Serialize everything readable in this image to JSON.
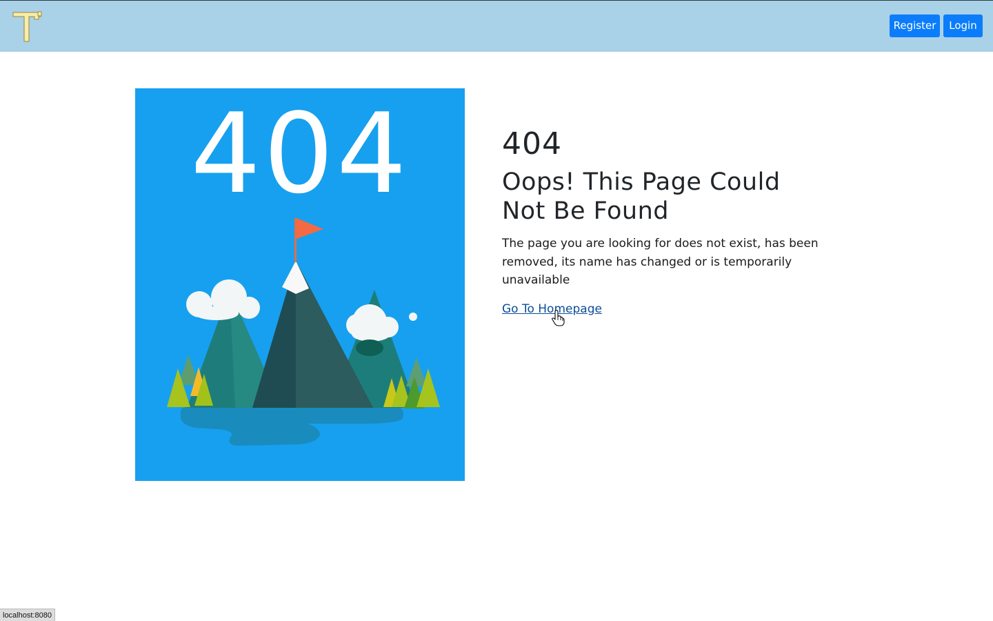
{
  "header": {
    "logo_icon": "hammer-icon",
    "register_label": "Register",
    "login_label": "Login",
    "background_color": "#a9d1e7",
    "button_color": "#0b7dfa"
  },
  "illustration": {
    "code_text": "404",
    "background_color": "#17a0ef",
    "icons": [
      "mountain-icon",
      "flag-icon",
      "cloud-icon",
      "tree-icon",
      "lake-icon"
    ]
  },
  "main": {
    "code": "404",
    "title": "Oops! This Page Could Not Be Found",
    "message": "The page you are looking for does not exist, has been removed, its name has changed or is temporarily unavailable",
    "link_label": "Go To Homepage",
    "link_color": "#0a4e9a"
  },
  "status_bar": {
    "url": "localhost:8080"
  }
}
